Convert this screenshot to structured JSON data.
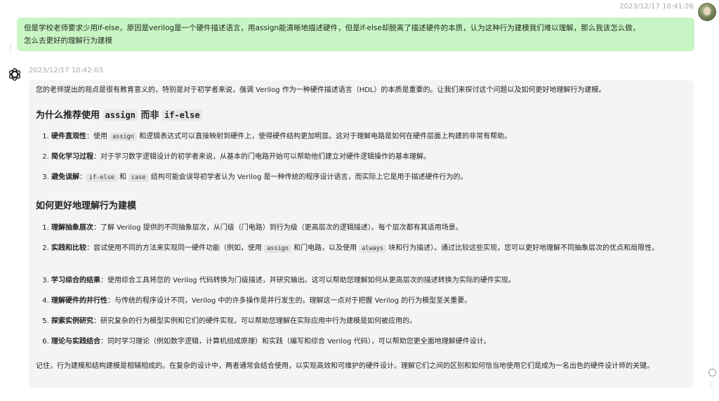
{
  "user": {
    "timestamp": "2023/12/17 10:41:26",
    "message_line1": "但是学校老师要求少用if-else，原因是verilog是一个硬件描述语言，用assign能清晰地描述硬件，但是if-else却脱离了描述硬件的本质，认为这种行为建模我们难以理解，那么我该怎么做，",
    "message_line2": "怎么去更好的理解行为建模"
  },
  "assistant": {
    "timestamp": "2023/12/17 10:42:03",
    "intro": "您的老师提出的观点是很有教育意义的，特别是对于初学者来说，强调 Verilog 作为一种硬件描述语言（HDL）的本质是重要的。让我们来探讨这个问题以及如何更好地理解行为建模。",
    "heading1_prefix": "为什么推荐使用",
    "heading1_code1": "assign",
    "heading1_mid": "而非",
    "heading1_code2": "if-else",
    "list1": [
      {
        "title": "硬件直观性",
        "pre": "：使用 ",
        "code": "assign",
        "post": " 和逻辑表达式可以直接映射到硬件上，使得硬件结构更加明显。这对于理解电路是如何在硬件层面上构建的非常有帮助。"
      },
      {
        "title": "简化学习过程",
        "text": "：对于学习数字逻辑设计的初学者来说，从基本的门电路开始可以帮助他们建立对硬件逻辑操作的基本理解。"
      },
      {
        "title": "避免误解",
        "pre": "：",
        "code1": "if-else",
        "mid": " 和 ",
        "code2": "case",
        "post": " 结构可能会误导初学者认为 Verilog 是一种传统的程序设计语言，而实际上它是用于描述硬件行为的。"
      }
    ],
    "heading2": "如何更好地理解行为建模",
    "list2": [
      {
        "title": "理解抽象层次",
        "text": "：了解 Verilog 提供的不同抽象层次，从门级（门电路）到行为级（更高层次的逻辑描述）。每个层次都有其适用场景。"
      },
      {
        "title": "实践和比较",
        "pre": "：尝试使用不同的方法来实现同一硬件功能（例如，使用 ",
        "code1": "assign",
        "mid": " 和门电路，以及使用 ",
        "code2": "always",
        "post": " 块和行为描述）。通过比较这些实现，您可以更好地理解不同抽象层次的优点和局限性。"
      },
      {
        "title": "学习综合的结果",
        "text": "：使用综合工具将您的 Verilog 代码转换为门级描述，并研究输出。这可以帮助您理解如何从更高层次的描述转换为实际的硬件实现。"
      },
      {
        "title": "理解硬件的并行性",
        "text": "：与传统的程序设计不同，Verilog 中的许多操作是并行发生的。理解这一点对于把握 Verilog 的行为模型至关重要。"
      },
      {
        "title": "探索实例研究",
        "text": "：研究复杂的行为模型实例和它们的硬件实现，可以帮助您理解在实际应用中行为建模是如何被应用的。"
      },
      {
        "title": "理论与实践结合",
        "text": "：同时学习理论（例如数字逻辑，计算机组成原理）和实践（编写和综合 Verilog 代码），可以帮助您更全面地理解硬件设计。"
      }
    ],
    "outro": "记住，行为建模和结构建模是相辅相成的。在复杂的设计中，两者通常会结合使用，以实现高效和可维护的硬件设计。理解它们之间的区别和如何恰当地使用它们是成为一名出色的硬件设计师的关键。"
  },
  "icons": {
    "user_avatar": "user-avatar",
    "bot_logo": "openai-logo-icon",
    "more": "more-vertical-icon",
    "circle": "circle-icon"
  },
  "colors": {
    "user_bubble": "#c9f5c4",
    "bot_bubble": "#f4f4f5",
    "timestamp": "#a8a8a8"
  }
}
